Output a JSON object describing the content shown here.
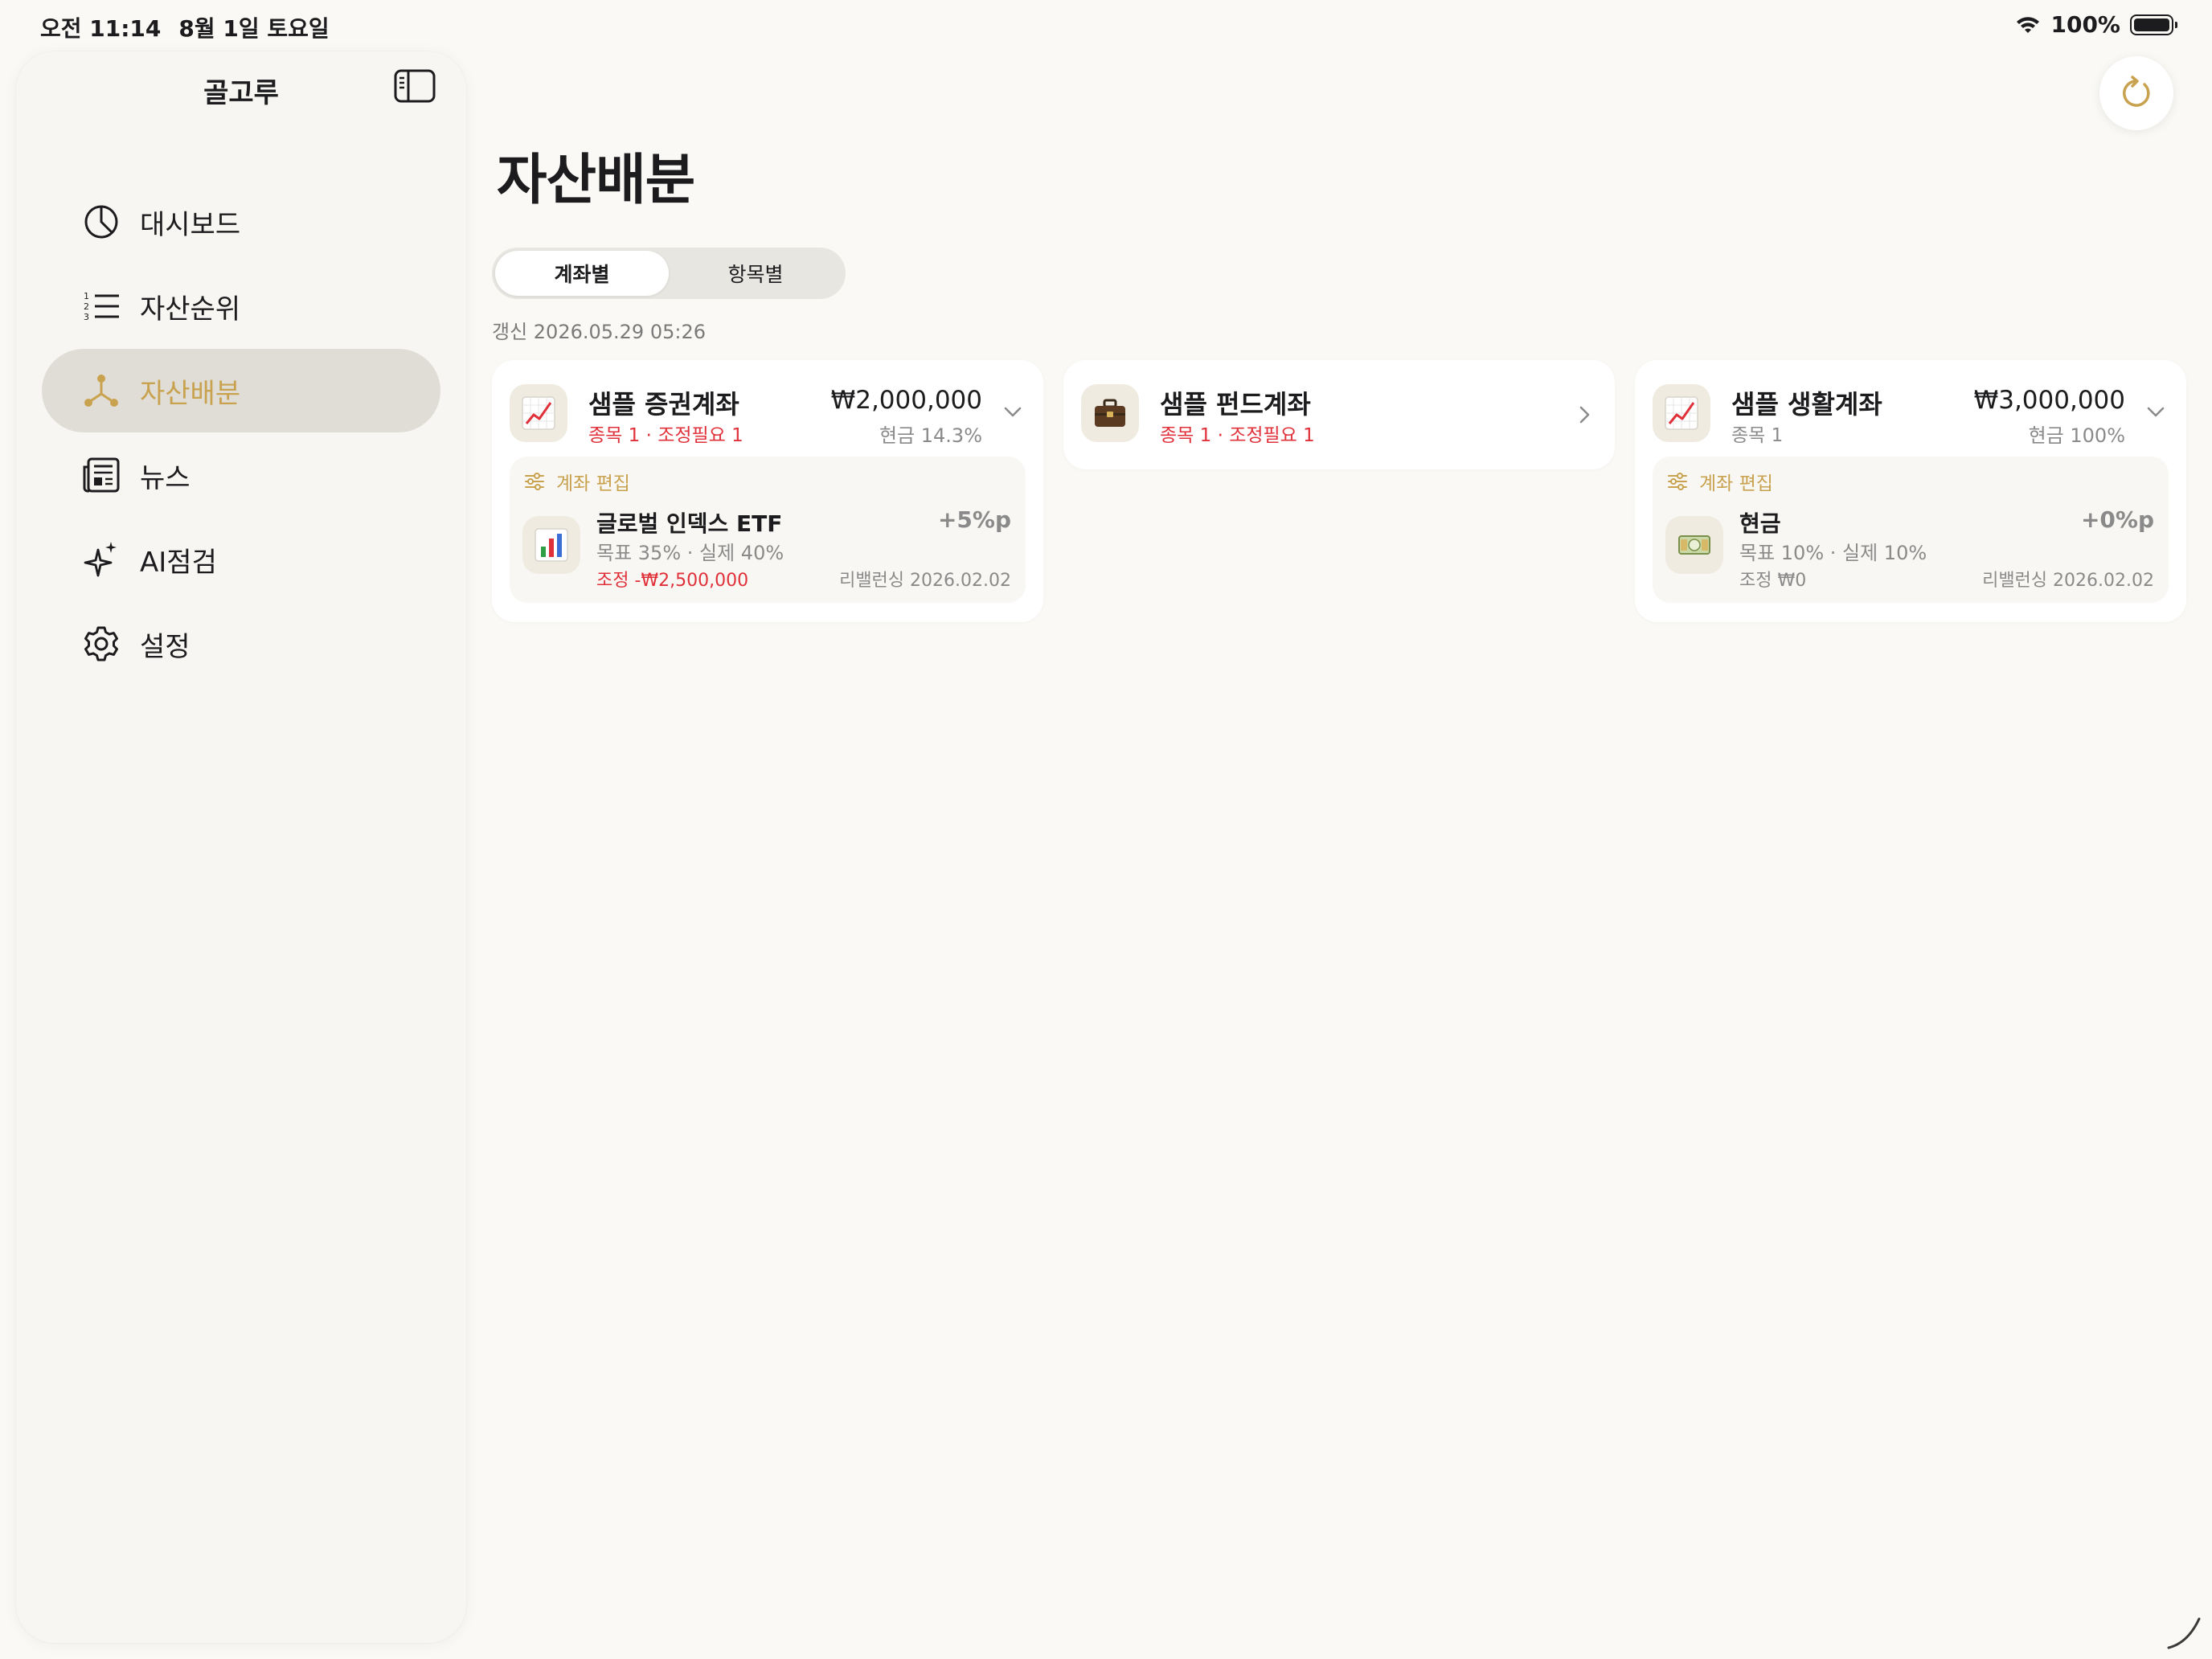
{
  "status_bar": {
    "time": "오전 11:14",
    "date": "8월 1일 토요일",
    "battery": "100%",
    "battery_level": 1.0
  },
  "sidebar": {
    "title": "골고루",
    "items": [
      {
        "label": "대시보드",
        "icon": "pie-chart-icon"
      },
      {
        "label": "자산순위",
        "icon": "numbered-list-icon"
      },
      {
        "label": "자산배분",
        "icon": "allocation-nodes-icon",
        "active": true
      },
      {
        "label": "뉴스",
        "icon": "newspaper-icon"
      },
      {
        "label": "AI점검",
        "icon": "sparkles-icon"
      },
      {
        "label": "설정",
        "icon": "gear-icon"
      }
    ]
  },
  "main": {
    "title": "자산배분",
    "segments": [
      "계좌별",
      "항목별"
    ],
    "selected_segment": "계좌별",
    "updated": "갱신 2026.05.29 05:26"
  },
  "accounts": [
    {
      "name": "샘플 증권계좌",
      "summary": "종목 1 · 조정필요 1",
      "amount": "₩2,000,000",
      "cash": "현금 14.3%",
      "edit_label": "계좌 편집",
      "item": {
        "name": "글로벌 인덱스 ETF",
        "target": "목표 35% · 실제 40%",
        "adjust": "조정 -₩2,500,000",
        "delta": "+5%p",
        "rebalance": "리밸런싱 2026.02.02"
      }
    },
    {
      "name": "샘플 펀드계좌",
      "summary": "종목 1 · 조정필요 1"
    },
    {
      "name": "샘플 생활계좌",
      "summary": "종목 1",
      "amount": "₩3,000,000",
      "cash": "현금 100%",
      "edit_label": "계좌 편집",
      "item": {
        "name": "현금",
        "target": "목표 10% · 실제 10%",
        "adjust": "조정 ₩0",
        "delta": "+0%p",
        "rebalance": "리밸런싱 2026.02.02"
      }
    }
  ],
  "colors": {
    "accent": "#c9a24f",
    "warning": "#e0313a",
    "background": "#faf9f5"
  }
}
